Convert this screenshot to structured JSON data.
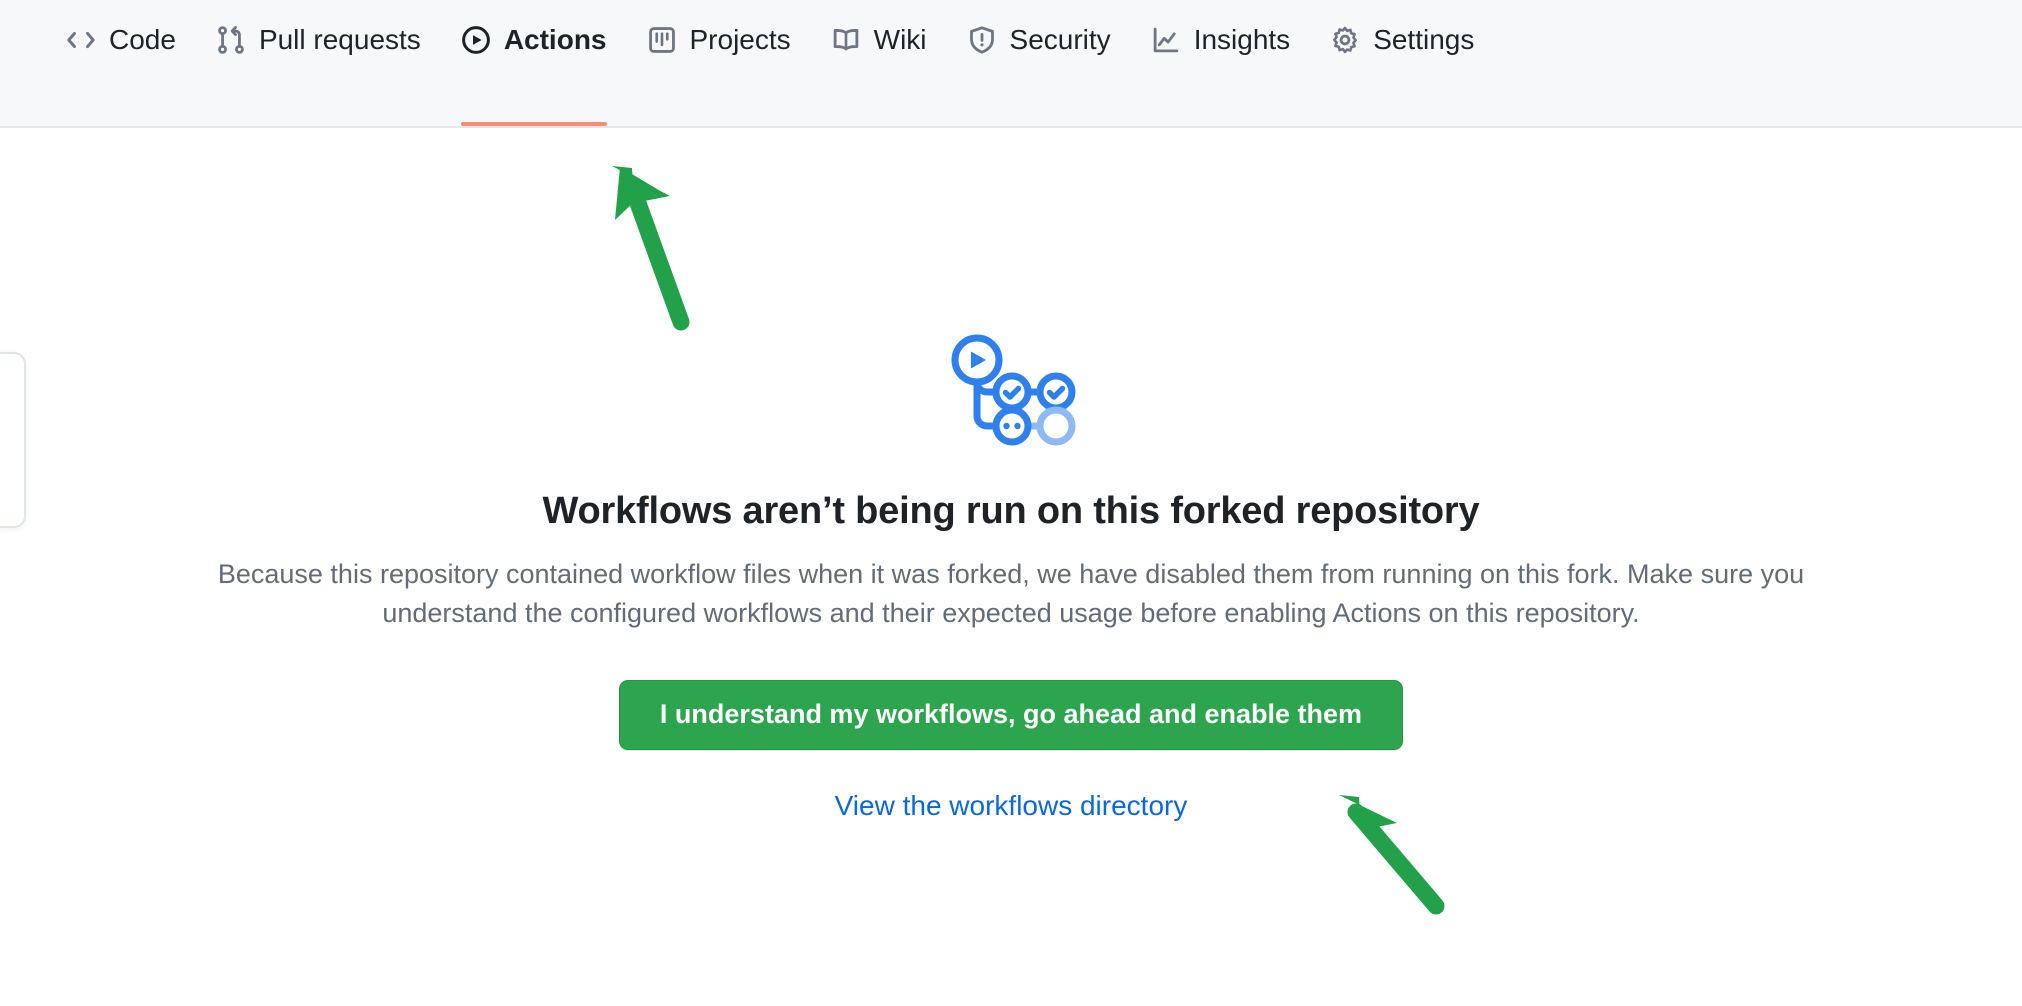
{
  "colors": {
    "nav_background": "#f6f8fa",
    "nav_border": "#e4e7eb",
    "selected_tab_underline": "#fd8c73",
    "primary_button": "#2da44e",
    "link": "#0969da",
    "heading_text": "#1f2328",
    "body_text": "#636c76",
    "icon_gray": "#6e7781",
    "annotation_arrow": "#22a04a",
    "illustration_blue": "#2f80ed",
    "illustration_blue_light": "#8fb9f5"
  },
  "repo_nav": {
    "items": [
      {
        "label": "Code",
        "icon": "code-icon",
        "selected": false
      },
      {
        "label": "Pull requests",
        "icon": "git-pull-request-icon",
        "selected": false
      },
      {
        "label": "Actions",
        "icon": "play-circle-icon",
        "selected": true
      },
      {
        "label": "Projects",
        "icon": "project-board-icon",
        "selected": false
      },
      {
        "label": "Wiki",
        "icon": "book-icon",
        "selected": false
      },
      {
        "label": "Security",
        "icon": "shield-alert-icon",
        "selected": false
      },
      {
        "label": "Insights",
        "icon": "graph-icon",
        "selected": false
      },
      {
        "label": "Settings",
        "icon": "gear-icon",
        "selected": false
      }
    ]
  },
  "blankslate": {
    "graphic_icon": "workflow-graph-illustration",
    "heading": "Workflows aren’t being run on this forked repository",
    "body": "Because this repository contained workflow files when it was forked, we have disabled them from running on this fork. Make sure you understand the configured workflows and their expected usage before enabling Actions on this repository.",
    "primary_button_label": "I understand my workflows, go ahead and enable them",
    "secondary_link_label": "View the workflows directory"
  },
  "annotations": [
    {
      "name": "arrow-pointing-to-actions-tab",
      "icon": "arrow-up-left-icon",
      "color": "#22a04a"
    },
    {
      "name": "arrow-pointing-to-enable-button",
      "icon": "arrow-up-left-icon",
      "color": "#22a04a"
    }
  ]
}
